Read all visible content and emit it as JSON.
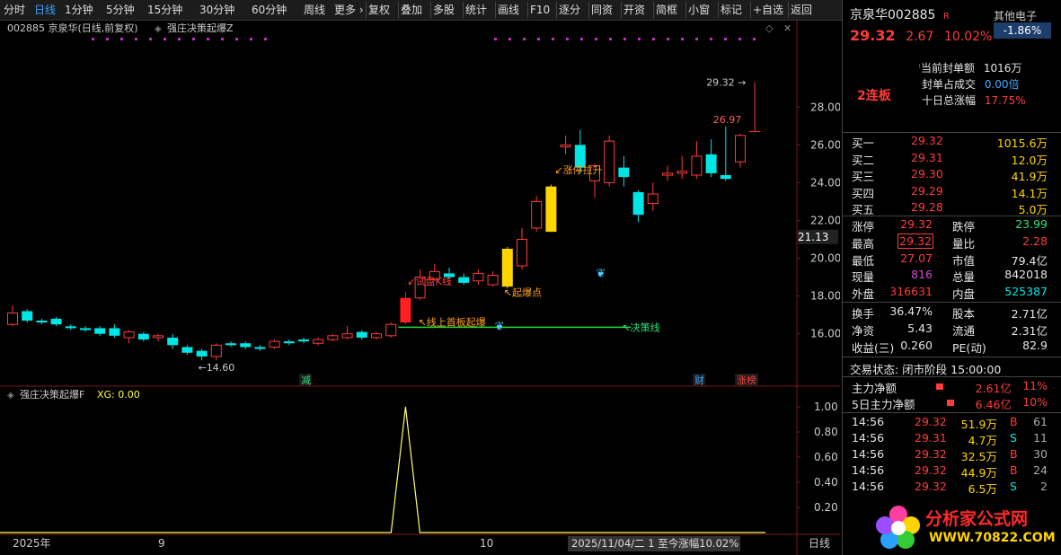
{
  "toolbar": {
    "left": [
      "分时",
      "日线",
      "1分钟",
      "5分钟",
      "15分钟",
      "30分钟",
      "60分钟",
      "周线",
      "更多 ›"
    ],
    "right": [
      "复权",
      "叠加",
      "多股",
      "统计",
      "画线",
      "F10",
      "逐分",
      "同资",
      "开资",
      "简框",
      "小窗",
      "标记",
      "+自选",
      "返回"
    ],
    "active": "日线"
  },
  "chart_header": {
    "code_title": "002885 京泉华(日线,前复权)",
    "indicator": "强庄决策起爆Z"
  },
  "price_axis": [
    "28.00",
    "26.00",
    "24.00",
    "22.00",
    "20.00",
    "18.00",
    "16.00"
  ],
  "current_price_tag": "21.13",
  "price_markers": {
    "high": "29.32",
    "prev_high": "26.97",
    "low": "14.60"
  },
  "annotations": {
    "test": "试盘K线",
    "breakout": "起爆点",
    "first_board": "线上首板起爆",
    "decision_line": "决策线",
    "limit_up": "涨停拉升",
    "reduce": "减",
    "finance": "财",
    "rank": "涨榜"
  },
  "sub_header": {
    "name": "强庄决策起爆F",
    "xg_label": "XG: 0.00"
  },
  "sub_axis": [
    "1.00",
    "0.80",
    "0.60",
    "0.40",
    "0.20"
  ],
  "bottom_axis": {
    "labels": [
      "2025年",
      "9",
      "10"
    ],
    "status": "2025/11/04/二 1 至今涨幅10.02%",
    "period": "日线"
  },
  "chart_data": {
    "type": "candlestick",
    "ylim": [
      13.8,
      30.2
    ],
    "candles": [
      {
        "o": 16.5,
        "c": 17.1,
        "h": 17.5,
        "l": 16.4
      },
      {
        "o": 17.2,
        "c": 16.7,
        "h": 17.3,
        "l": 16.6
      },
      {
        "o": 16.7,
        "c": 16.6,
        "h": 16.8,
        "l": 16.5
      },
      {
        "o": 16.8,
        "c": 16.5,
        "h": 16.9,
        "l": 16.4
      },
      {
        "o": 16.4,
        "c": 16.3,
        "h": 16.5,
        "l": 16.2
      },
      {
        "o": 16.3,
        "c": 16.2,
        "h": 16.4,
        "l": 16.1
      },
      {
        "o": 16.3,
        "c": 16.0,
        "h": 16.4,
        "l": 15.9
      },
      {
        "o": 16.3,
        "c": 15.9,
        "h": 16.5,
        "l": 15.8
      },
      {
        "o": 15.8,
        "c": 16.1,
        "h": 16.2,
        "l": 15.5
      },
      {
        "o": 16.0,
        "c": 15.7,
        "h": 16.1,
        "l": 15.6
      },
      {
        "o": 15.8,
        "c": 15.9,
        "h": 16.0,
        "l": 15.6
      },
      {
        "o": 15.8,
        "c": 15.4,
        "h": 16.0,
        "l": 15.2
      },
      {
        "o": 15.3,
        "c": 15.0,
        "h": 15.4,
        "l": 14.9
      },
      {
        "o": 15.1,
        "c": 14.8,
        "h": 15.2,
        "l": 14.6
      },
      {
        "o": 14.8,
        "c": 15.4,
        "h": 15.5,
        "l": 14.6
      },
      {
        "o": 15.5,
        "c": 15.4,
        "h": 15.6,
        "l": 15.3
      },
      {
        "o": 15.5,
        "c": 15.3,
        "h": 15.6,
        "l": 15.2
      },
      {
        "o": 15.3,
        "c": 15.2,
        "h": 15.4,
        "l": 15.1
      },
      {
        "o": 15.3,
        "c": 15.6,
        "h": 15.7,
        "l": 15.2
      },
      {
        "o": 15.6,
        "c": 15.5,
        "h": 15.7,
        "l": 15.4
      },
      {
        "o": 15.7,
        "c": 15.6,
        "h": 15.8,
        "l": 15.5
      },
      {
        "o": 15.5,
        "c": 15.7,
        "h": 15.8,
        "l": 15.4
      },
      {
        "o": 15.7,
        "c": 15.9,
        "h": 16.0,
        "l": 15.6
      },
      {
        "o": 15.8,
        "c": 16.0,
        "h": 16.4,
        "l": 15.7
      },
      {
        "o": 16.1,
        "c": 15.8,
        "h": 16.2,
        "l": 15.7
      },
      {
        "o": 15.8,
        "c": 16.0,
        "h": 16.1,
        "l": 15.7
      },
      {
        "o": 15.9,
        "c": 16.5,
        "h": 16.6,
        "l": 15.8
      },
      {
        "o": 16.6,
        "c": 17.9,
        "h": 18.2,
        "l": 16.5,
        "style": "limit"
      },
      {
        "o": 17.9,
        "c": 19.0,
        "h": 19.4,
        "l": 17.8
      },
      {
        "o": 18.9,
        "c": 19.3,
        "h": 19.7,
        "l": 18.8
      },
      {
        "o": 19.2,
        "c": 19.0,
        "h": 19.5,
        "l": 18.9
      },
      {
        "o": 19.0,
        "c": 18.7,
        "h": 19.2,
        "l": 18.6
      },
      {
        "o": 18.8,
        "c": 19.2,
        "h": 19.4,
        "l": 18.6
      },
      {
        "o": 18.6,
        "c": 19.1,
        "h": 19.3,
        "l": 18.5
      },
      {
        "o": 18.5,
        "c": 20.5,
        "h": 20.6,
        "l": 18.4,
        "style": "gold"
      },
      {
        "o": 19.6,
        "c": 21.0,
        "h": 21.6,
        "l": 19.4
      },
      {
        "o": 21.6,
        "c": 23.0,
        "h": 23.3,
        "l": 21.4
      },
      {
        "o": 21.4,
        "c": 23.8,
        "h": 23.9,
        "l": 21.4,
        "style": "gold"
      },
      {
        "o": 25.9,
        "c": 26.0,
        "h": 26.5,
        "l": 25.5
      },
      {
        "o": 26.0,
        "c": 24.8,
        "h": 26.8,
        "l": 24.5
      },
      {
        "o": 24.1,
        "c": 24.9,
        "h": 25.0,
        "l": 23.2
      },
      {
        "o": 24.0,
        "c": 26.2,
        "h": 26.5,
        "l": 23.8
      },
      {
        "o": 24.8,
        "c": 24.3,
        "h": 25.4,
        "l": 23.8
      },
      {
        "o": 23.5,
        "c": 22.3,
        "h": 23.6,
        "l": 21.9
      },
      {
        "o": 22.9,
        "c": 23.4,
        "h": 24.0,
        "l": 22.5
      },
      {
        "o": 24.4,
        "c": 24.5,
        "h": 24.9,
        "l": 24.1
      },
      {
        "o": 24.5,
        "c": 24.6,
        "h": 25.4,
        "l": 24.2
      },
      {
        "o": 24.4,
        "c": 25.4,
        "h": 26.2,
        "l": 24.2
      },
      {
        "o": 25.5,
        "c": 24.5,
        "h": 26.3,
        "l": 24.3
      },
      {
        "o": 24.4,
        "c": 24.2,
        "h": 26.97,
        "l": 24.1
      },
      {
        "o": 25.1,
        "c": 26.5,
        "h": 26.6,
        "l": 24.8
      },
      {
        "o": 26.7,
        "c": 29.32,
        "h": 29.32,
        "l": 26.7,
        "style": "line"
      }
    ],
    "decision_line": {
      "value": 16.35,
      "from_index": 27,
      "to_index": 42
    },
    "signal": {
      "xg_index": 27,
      "value": 1.0
    }
  },
  "stock": {
    "name": "京泉华",
    "code": "002885",
    "badge": "R",
    "sector": "其他电子",
    "sector_change": "-1.86%",
    "price": "29.32",
    "change": "2.67",
    "change_pct": "10.02%",
    "board": "2连板",
    "seal_label": "当前封单额",
    "seal_value": "1016万",
    "seal_ratio_label": "封单占成交",
    "seal_ratio": "0.00倍",
    "ten_day_label": "十日总涨幅",
    "ten_day": "17.75%"
  },
  "bids": [
    {
      "label": "买一",
      "price": "29.32",
      "vol": "1015.6万"
    },
    {
      "label": "买二",
      "price": "29.31",
      "vol": "12.0万"
    },
    {
      "label": "买三",
      "price": "29.30",
      "vol": "41.9万"
    },
    {
      "label": "买四",
      "price": "29.29",
      "vol": "14.1万"
    },
    {
      "label": "买五",
      "price": "29.28",
      "vol": "5.0万"
    }
  ],
  "stats1": [
    {
      "l1": "涨停",
      "v1": "29.32",
      "c1": "red",
      "l2": "跌停",
      "v2": "23.99",
      "c2": "grn2"
    },
    {
      "l1": "最高",
      "v1": "29.32",
      "c1": "red",
      "l2": "量比",
      "v2": "2.28",
      "c2": "red"
    },
    {
      "l1": "最低",
      "v1": "27.07",
      "c1": "red",
      "l2": "市值",
      "v2": "79.4亿",
      "c2": "white"
    },
    {
      "l1": "现量",
      "v1": "816",
      "c1": "purple",
      "l2": "总量",
      "v2": "842018",
      "c2": "white"
    },
    {
      "l1": "外盘",
      "v1": "316631",
      "c1": "red",
      "l2": "内盘",
      "v2": "525387",
      "c2": "green"
    }
  ],
  "stats2": [
    {
      "l1": "换手",
      "v1": "36.47%",
      "l2": "股本",
      "v2": "2.71亿"
    },
    {
      "l1": "净资",
      "v1": "5.43",
      "l2": "流通",
      "v2": "2.31亿"
    },
    {
      "l1": "收益(三)",
      "v1": "0.260",
      "l2": "PE(动)",
      "v2": "82.9"
    }
  ],
  "trade_status": "交易状态: 闭市阶段 15:00:00",
  "flows": [
    {
      "label": "主力净额",
      "value": "2.61亿",
      "pct": "11%"
    },
    {
      "label": "5日主力净额",
      "value": "6.46亿",
      "pct": "10%"
    }
  ],
  "ticks": [
    {
      "t": "14:56",
      "p": "29.32",
      "v": "51.9万",
      "s": "B",
      "n": "61"
    },
    {
      "t": "14:56",
      "p": "29.31",
      "v": "4.7万",
      "s": "S",
      "n": "11"
    },
    {
      "t": "14:56",
      "p": "29.32",
      "v": "32.5万",
      "s": "B",
      "n": "30"
    },
    {
      "t": "14:56",
      "p": "29.32",
      "v": "44.9万",
      "s": "B",
      "n": "24"
    },
    {
      "t": "14:56",
      "p": "29.32",
      "v": "6.5万",
      "s": "S",
      "n": "2"
    }
  ],
  "logo": {
    "name": "分析家公式网",
    "url": "WWW.70822.COM"
  },
  "colors": {
    "up": "#ff3b3b",
    "down": "#00e5e5",
    "gold": "#ffd400",
    "limit": "#ff2020",
    "line": "#22dd33",
    "signal": "#ffff66"
  }
}
